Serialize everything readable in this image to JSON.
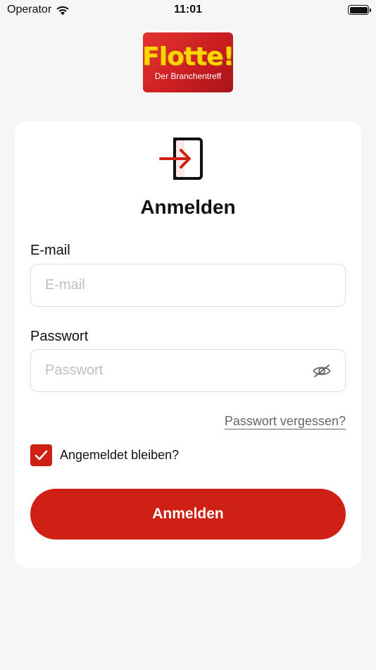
{
  "status_bar": {
    "carrier": "Operator",
    "time": "11:01",
    "wifi_icon": "wifi-icon",
    "battery_icon": "battery-icon"
  },
  "logo": {
    "main": "Flotte!",
    "sub": "Der Branchentreff"
  },
  "login_form": {
    "icon": "login-icon",
    "title": "Anmelden",
    "email": {
      "label": "E-mail",
      "placeholder": "E-mail",
      "value": ""
    },
    "password": {
      "label": "Passwort",
      "placeholder": "Passwort",
      "value": "",
      "toggle_icon": "eye-slash-icon"
    },
    "forgot_password": "Passwort vergessen?",
    "remember_me": {
      "label": "Angemeldet bleiben?",
      "checked": true
    },
    "submit_label": "Anmelden"
  },
  "colors": {
    "accent": "#cf2016",
    "logo_yellow": "#ffd400",
    "background": "#f6f6f6",
    "card": "#ffffff"
  }
}
